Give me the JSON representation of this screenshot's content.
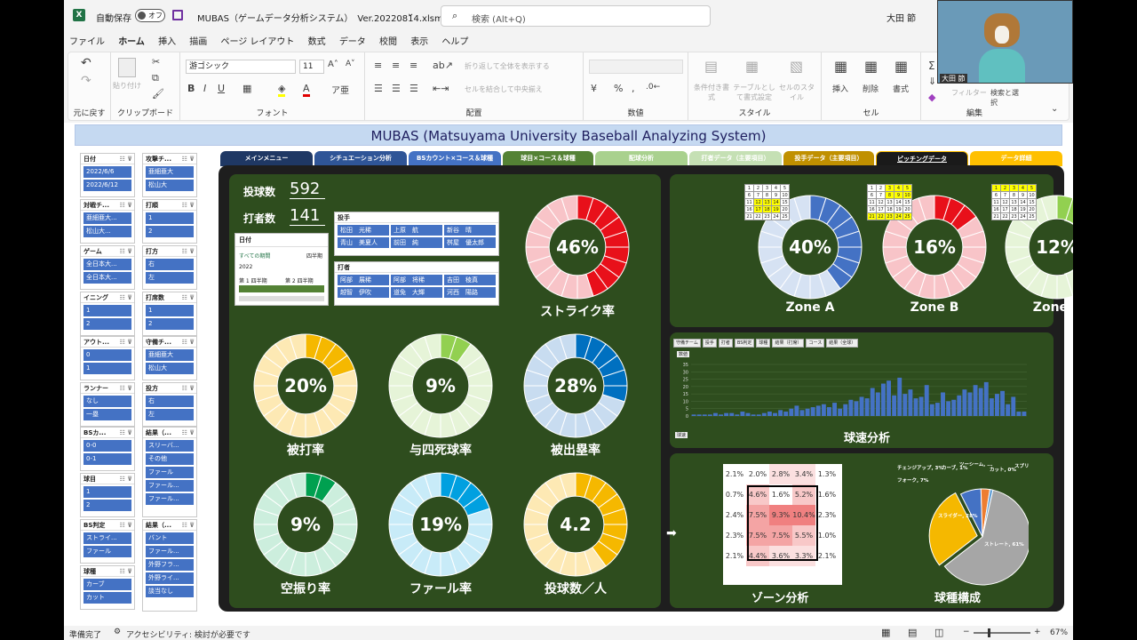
{
  "app": {
    "autosave_label": "自動保存",
    "autosave_state": "オフ",
    "filename": "MUBAS（ゲームデータ分析システム）　Ver.20220814.xlsm",
    "search_placeholder": "検索 (Alt+Q)",
    "user": "大田 節"
  },
  "menu_tabs": [
    "ファイル",
    "ホーム",
    "挿入",
    "描画",
    "ページ レイアウト",
    "数式",
    "データ",
    "校閲",
    "表示",
    "ヘルプ"
  ],
  "ribbon": {
    "groups": {
      "undo": "元に戻す",
      "clipboard": "クリップボード",
      "font": "フォント",
      "alignment": "配置",
      "number": "数値",
      "styles": "スタイル",
      "cells": "セル",
      "editing": "編集"
    },
    "paste": "貼り付け",
    "font_name": "游ゴシック",
    "font_size": "11",
    "wrap_text": "折り返して全体を表示する",
    "merge_center": "セルを結合して中央揃え",
    "cond_format": "条件付き書式",
    "table_format": "テーブルとして書式設定",
    "cell_styles": "セルのスタイル",
    "insert": "挿入",
    "delete": "削除",
    "format": "書式",
    "filter": "フィルター",
    "find_select": "検索と選択"
  },
  "header_banner": "MUBAS  (Matsuyama University Baseball Analyzing System)",
  "nav_tabs": [
    {
      "label": "メインメニュー",
      "color": "#1f3864"
    },
    {
      "label": "シチュエーション分析",
      "color": "#2f5597"
    },
    {
      "label": "BSカウント×コース＆球種",
      "color": "#4472c4"
    },
    {
      "label": "球目×コース＆球種",
      "color": "#548235"
    },
    {
      "label": "配球分析",
      "color": "#a9d18e"
    },
    {
      "label": "打者データ（主要項目）",
      "color": "#c5e0b4"
    },
    {
      "label": "投手データ（主要項目）",
      "color": "#c09000"
    },
    {
      "label": "ピッチングデータ",
      "color": "#1a1a1a"
    },
    {
      "label": "データ詳細",
      "color": "#ffc000"
    }
  ],
  "side_slicers": [
    {
      "title": "日付",
      "items": [
        "2022/6/6",
        "2022/6/12"
      ]
    },
    {
      "title": "攻撃チ...",
      "items": [
        "亜細亜大",
        "松山大"
      ]
    },
    {
      "title": "対戦チ...",
      "items": [
        "亜細亜大...",
        "松山大..."
      ]
    },
    {
      "title": "打順",
      "items": [
        "1",
        "2"
      ]
    },
    {
      "title": "ゲーム",
      "items": [
        "全日本大...",
        "全日本大..."
      ]
    },
    {
      "title": "打方",
      "items": [
        "右",
        "左"
      ]
    },
    {
      "title": "イニング",
      "items": [
        "1",
        "2"
      ]
    },
    {
      "title": "打席数",
      "items": [
        "1",
        "2"
      ]
    },
    {
      "title": "アウト...",
      "items": [
        "0",
        "1"
      ]
    },
    {
      "title": "守備チ...",
      "items": [
        "亜細亜大",
        "松山大"
      ]
    },
    {
      "title": "ランナー",
      "items": [
        "なし",
        "一塁"
      ]
    },
    {
      "title": "投方",
      "items": [
        "右",
        "左"
      ]
    },
    {
      "title": "BSカ...",
      "items": [
        "0-0",
        "0-1"
      ]
    },
    {
      "title": "結果（...",
      "items": [
        "スリーバ...",
        "その他",
        "ファール",
        "ファール...",
        "ファール..."
      ]
    },
    {
      "title": "球目",
      "items": [
        "1",
        "2"
      ]
    },
    {
      "title": "BS判定",
      "items": [
        "ストライ...",
        "ファール"
      ]
    },
    {
      "title": "結果（...",
      "items": [
        "バント",
        "ファール...",
        "外野フラ...",
        "外野ライ...",
        "談当なし"
      ]
    },
    {
      "title": "球種",
      "items": [
        "カーブ",
        "カット"
      ]
    }
  ],
  "stats": {
    "pitches_label": "投球数",
    "pitches_value": "592",
    "batters_label": "打者数",
    "batters_value": "141"
  },
  "pitcher_slicer": {
    "title": "投手",
    "items": [
      "松田　光稀",
      "上原　航",
      "新谷　晴",
      "青山　美夏人",
      "前田　純",
      "桝屋　優太郎"
    ]
  },
  "batter_slicer": {
    "title": "打者",
    "items": [
      "阿部　展稀",
      "阿部　将稀",
      "吉田　稜真",
      "越智　伊吹",
      "道免　大輝",
      "河西　陽路"
    ]
  },
  "timeline": {
    "title": "日付",
    "period": "すべての期間",
    "unit": "四半期",
    "year": "2022",
    "q1": "第 1 四半期",
    "q2": "第 2 四半期"
  },
  "donuts": [
    {
      "value": "46%",
      "label": "ストライク率",
      "pct": 46,
      "fill": "#e8101a",
      "light": "#f8c4c8"
    },
    {
      "value": "20%",
      "label": "被打率",
      "pct": 20,
      "fill": "#f5b800",
      "light": "#fde9b4"
    },
    {
      "value": "9%",
      "label": "与四死球率",
      "pct": 9,
      "fill": "#92d050",
      "light": "#e6f4d8"
    },
    {
      "value": "28%",
      "label": "被出塁率",
      "pct": 28,
      "fill": "#0070c0",
      "light": "#c8dcf0"
    },
    {
      "value": "9%",
      "label": "空振り率",
      "pct": 9,
      "fill": "#00a050",
      "light": "#cceedd"
    },
    {
      "value": "19%",
      "label": "ファール率",
      "pct": 19,
      "fill": "#00a0e0",
      "light": "#c8ebf8"
    },
    {
      "value": "4.2",
      "label": "投球数／人",
      "pct": 42,
      "fill": "#f5b800",
      "light": "#fde9b4"
    }
  ],
  "zones": [
    {
      "value": "40%",
      "label": "Zone A",
      "pct": 40,
      "fill": "#4472c4",
      "light": "#d6e2f3"
    },
    {
      "value": "16%",
      "label": "Zone B",
      "pct": 16,
      "fill": "#e8101a",
      "light": "#f8c4c8"
    },
    {
      "value": "12%",
      "label": "Zone C",
      "pct": 12,
      "fill": "#92d050",
      "light": "#e6f4d8"
    }
  ],
  "mini_grids": [
    [
      "1",
      "2",
      "3",
      "4",
      "5",
      "6",
      "7",
      "8",
      "9",
      "10",
      "11",
      "12",
      "13",
      "14",
      "15",
      "16",
      "17",
      "18",
      "19",
      "20",
      "21",
      "22",
      "23",
      "24",
      "25"
    ],
    [
      "1",
      "2",
      "3",
      "4",
      "5",
      "6",
      "7",
      "8",
      "9",
      "10",
      "11",
      "12",
      "13",
      "14",
      "15",
      "16",
      "17",
      "18",
      "19",
      "20",
      "21",
      "22",
      "23",
      "24",
      "25"
    ],
    [
      "1",
      "2",
      "3",
      "4",
      "5",
      "6",
      "7",
      "8",
      "9",
      "10",
      "11",
      "12",
      "13",
      "14",
      "15",
      "16",
      "17",
      "18",
      "19",
      "20",
      "21",
      "22",
      "23",
      "24",
      "25"
    ]
  ],
  "speed_chart": {
    "title": "球速分析",
    "filters": [
      "守備チーム",
      "投手",
      "打者",
      "BS判定",
      "球種",
      "結果（打席）",
      "コース",
      "結果（全球）"
    ],
    "row_label": "数値",
    "x_label": "球速",
    "yticks": [
      "35",
      "30",
      "25",
      "20",
      "15",
      "10",
      "5",
      "0"
    ],
    "chart_data": {
      "type": "bar",
      "ylim": [
        0,
        35
      ],
      "values": [
        1,
        1,
        1,
        1,
        2,
        1,
        2,
        2,
        1,
        3,
        2,
        1,
        1,
        2,
        3,
        2,
        4,
        3,
        5,
        7,
        4,
        5,
        6,
        7,
        8,
        6,
        9,
        5,
        8,
        11,
        10,
        13,
        12,
        19,
        16,
        22,
        24,
        14,
        26,
        15,
        18,
        12,
        13,
        21,
        8,
        9,
        16,
        10,
        11,
        14,
        18,
        16,
        21,
        19,
        23,
        12,
        15,
        17,
        8,
        13,
        3,
        3
      ]
    }
  },
  "zone_analysis": {
    "title": "ゾーン分析",
    "rows": [
      [
        "2.1%",
        "2.0%",
        "2.8%",
        "3.4%",
        "1.3%"
      ],
      [
        "0.7%",
        "4.6%",
        "1.6%",
        "5.2%",
        "1.6%"
      ],
      [
        "2.4%",
        "7.5%",
        "9.3%",
        "10.4%",
        "2.3%"
      ],
      [
        "2.3%",
        "7.5%",
        "7.5%",
        "5.5%",
        "1.0%"
      ],
      [
        "2.1%",
        "4.4%",
        "3.6%",
        "3.3%",
        "2.1%"
      ]
    ]
  },
  "pitch_types": {
    "title": "球種構成",
    "chart_data": {
      "type": "pie",
      "slices": [
        {
          "name": "ストレート",
          "value": 61,
          "color": "#a6a6a6"
        },
        {
          "name": "スライダー",
          "value": 28,
          "color": "#f5b800"
        },
        {
          "name": "フォーク",
          "value": 7,
          "color": "#4472c4"
        },
        {
          "name": "チェンジアップ",
          "value": 3,
          "color": "#ed7d31"
        },
        {
          "name": "カーブ",
          "value": 1,
          "color": "#5b9bd5"
        },
        {
          "name": "ツーシーム",
          "value": 0,
          "color": "#70ad47"
        },
        {
          "name": "カット",
          "value": 0,
          "color": "#264478"
        },
        {
          "name": "スプリット",
          "value": 0,
          "color": "#9e480e"
        }
      ]
    },
    "labels": [
      "チェンジアップ, 3%",
      "カーブ, 1%",
      "ツーシーム, ...",
      "カット, 0%",
      "スプリット, 0%",
      "フォーク, 7%",
      "スライダー, 28%",
      "ストレート, 61%"
    ]
  },
  "status": {
    "ready": "準備完了",
    "accessibility": "アクセシビリティ: 検討が必要です",
    "zoom": "67%"
  },
  "colors": {
    "excel_green": "#217346",
    "panel_green": "#2e4d1e",
    "banner": "#c5d9f1"
  }
}
